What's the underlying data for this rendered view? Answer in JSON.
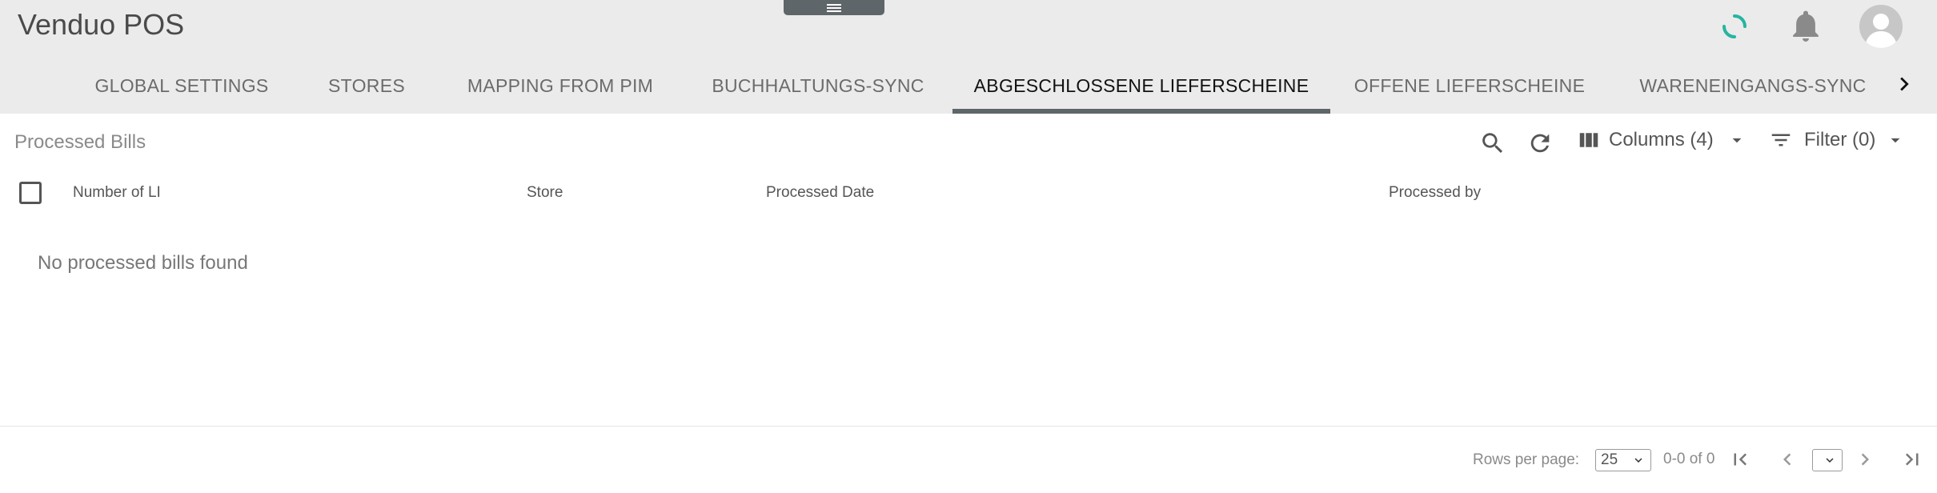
{
  "app": {
    "title": "Venduo POS"
  },
  "header": {
    "menu_icon": "menu-icon",
    "sync_icon": "loading-spinner-icon",
    "notifications_icon": "bell-icon",
    "avatar_icon": "user-avatar-icon",
    "accent_color": "#26b5a0"
  },
  "tabs": [
    {
      "label": "GLOBAL SETTINGS"
    },
    {
      "label": "STORES"
    },
    {
      "label": "MAPPING FROM PIM"
    },
    {
      "label": "BUCHHALTUNGS-SYNC"
    },
    {
      "label": "ABGESCHLOSSENE LIEFERSCHEINE",
      "active": true
    },
    {
      "label": "OFFENE LIEFERSCHEINE"
    },
    {
      "label": "WARENEINGANGS-SYNC"
    }
  ],
  "section": {
    "title": "Processed Bills"
  },
  "toolbar": {
    "search_icon": "search-icon",
    "refresh_icon": "refresh-icon",
    "columns_label": "Columns (4)",
    "filter_label": "Filter (0)"
  },
  "table": {
    "columns": [
      "Number of LI",
      "Store",
      "Processed Date",
      "Processed by"
    ],
    "empty_message": "No processed bills found"
  },
  "footer": {
    "rows_per_page_label": "Rows per page:",
    "rows_per_page_value": "25",
    "range_text": "0-0 of 0",
    "page_value": ""
  }
}
